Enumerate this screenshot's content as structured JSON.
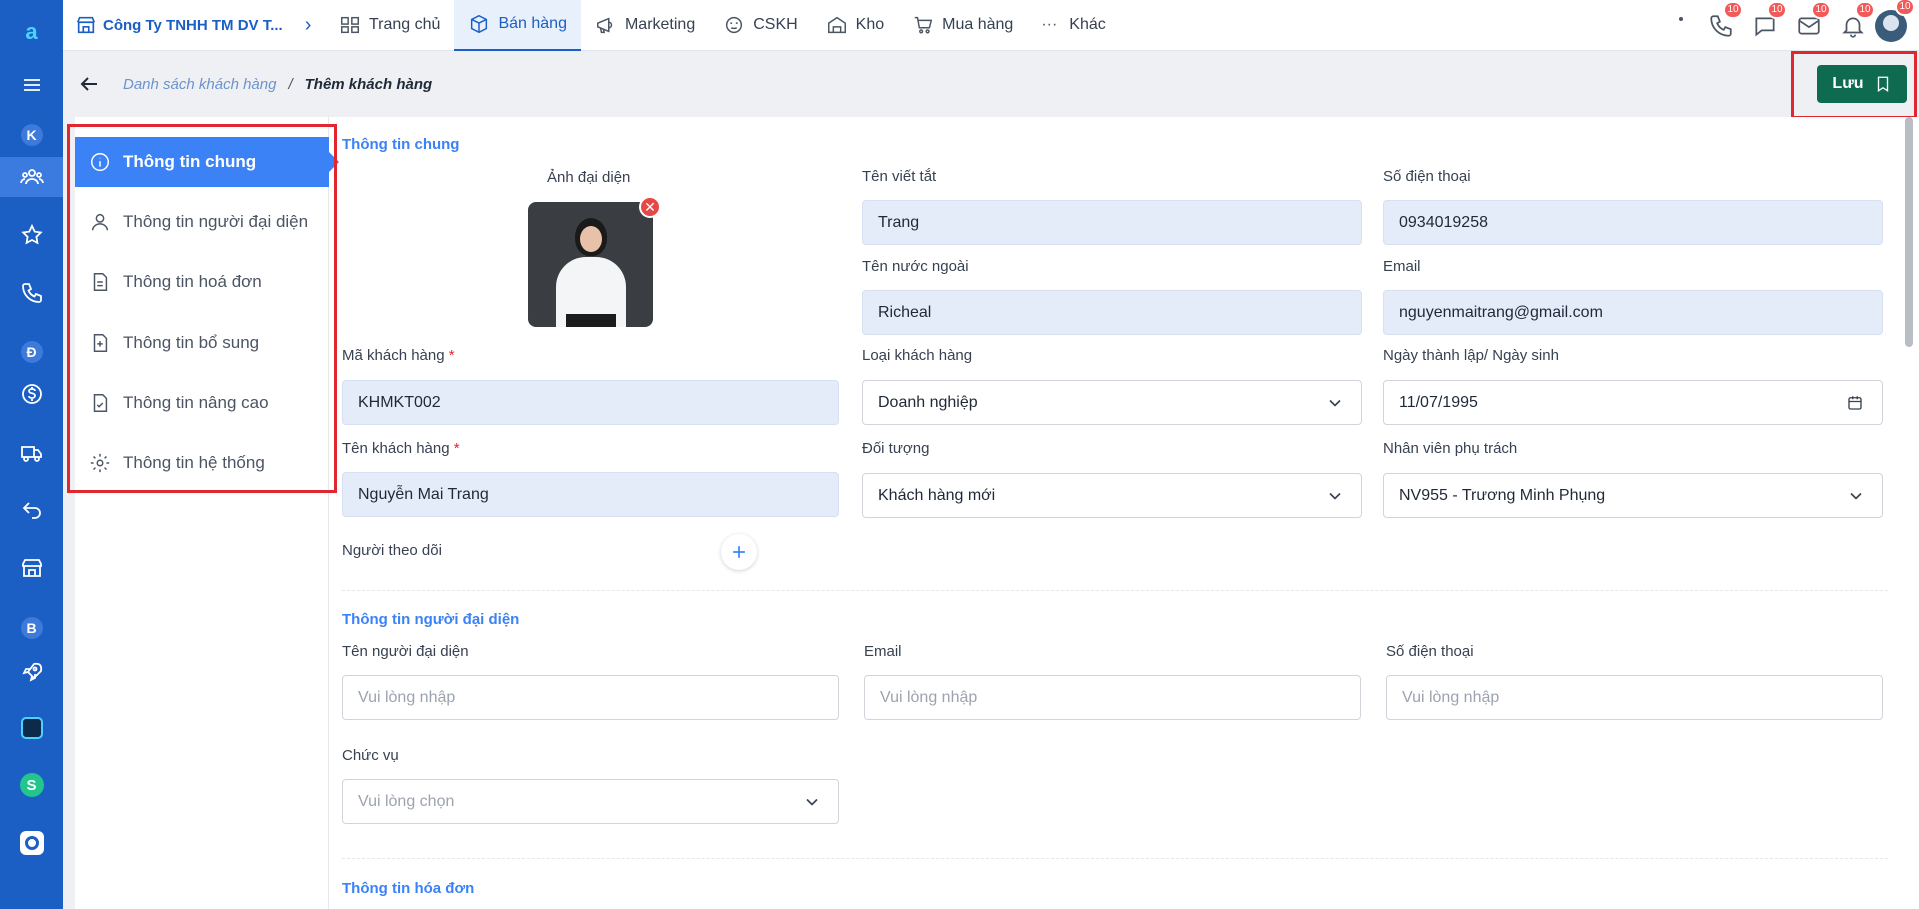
{
  "topbar": {
    "company": "Công Ty TNHH TM DV T...",
    "nav": [
      {
        "label": "Trang chủ",
        "icon": "home-grid-icon"
      },
      {
        "label": "Bán hàng",
        "icon": "box-icon"
      },
      {
        "label": "Marketing",
        "icon": "megaphone-icon"
      },
      {
        "label": "CSKH",
        "icon": "support-icon"
      },
      {
        "label": "Kho",
        "icon": "warehouse-icon"
      },
      {
        "label": "Mua hàng",
        "icon": "cart-icon"
      },
      {
        "label": "Khác",
        "icon": "more-icon"
      }
    ],
    "badges": {
      "phone": "10",
      "chat": "10",
      "mail": "10",
      "bell": "10",
      "user": "10"
    }
  },
  "rail": {
    "letters": {
      "k": "K",
      "d": "Đ",
      "b": "B"
    }
  },
  "breadcrumb": {
    "parent": "Danh sách khách hàng",
    "sep": "/",
    "current": "Thêm khách hàng"
  },
  "actions": {
    "save": "Lưu"
  },
  "menu": [
    "Thông tin chung",
    "Thông tin người đại diện",
    "Thông tin hoá đơn",
    "Thông tin bổ sung",
    "Thông tin nâng cao",
    "Thông tin hệ thống"
  ],
  "general": {
    "title": "Thông tin chung",
    "avatar_label": "Ảnh đại diện",
    "short_name": {
      "label": "Tên viết tắt",
      "value": "Trang"
    },
    "phone": {
      "label": "Số điện thoại",
      "value": "0934019258"
    },
    "foreign_name": {
      "label": "Tên nước ngoài",
      "value": "Richeal"
    },
    "email": {
      "label": "Email",
      "value": "nguyenmaitrang@gmail.com"
    },
    "code": {
      "label": "Mã khách hàng",
      "required": "*",
      "value": "KHMKT002"
    },
    "type": {
      "label": "Loại khách hàng",
      "value": "Doanh nghiệp"
    },
    "dob": {
      "label": "Ngày thành lập/ Ngày sinh",
      "value": "11/07/1995"
    },
    "name": {
      "label": "Tên khách hàng",
      "required": "*",
      "value": "Nguyễn Mai Trang"
    },
    "object": {
      "label": "Đối tượng",
      "value": "Khách hàng mới"
    },
    "staff": {
      "label": "Nhân viên phụ trách",
      "value": "NV955 - Trương Minh Phụng"
    },
    "followers": {
      "label": "Người theo dõi"
    }
  },
  "representative": {
    "title": "Thông tin người đại diện",
    "name": {
      "label": "Tên người đại diện",
      "placeholder": "Vui lòng nhập"
    },
    "email": {
      "label": "Email",
      "placeholder": "Vui lòng nhập"
    },
    "phone": {
      "label": "Số điện thoại",
      "placeholder": "Vui lòng nhập"
    },
    "position": {
      "label": "Chức vụ",
      "placeholder": "Vui lòng chọn"
    }
  },
  "invoice": {
    "title": "Thông tin hóa đơn"
  },
  "colors": {
    "brand": "#1b5fc4",
    "accent": "#3b82f6",
    "save": "#0e6b50",
    "highlight": "#e0262f"
  }
}
